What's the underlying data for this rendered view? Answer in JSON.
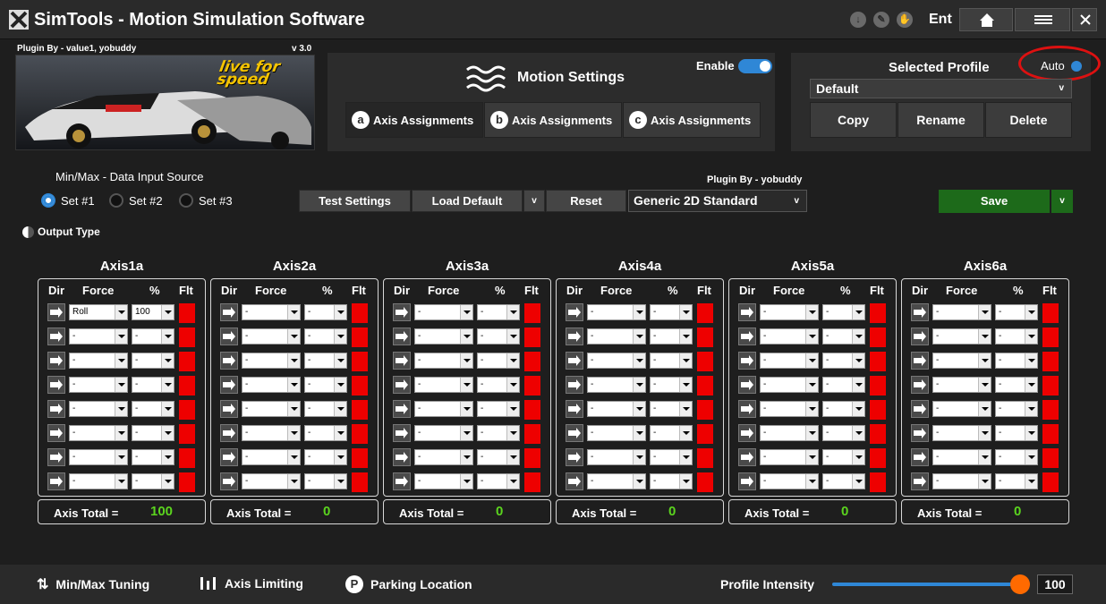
{
  "window": {
    "title": "SimTools - Motion Simulation Software",
    "user_label": "Ent"
  },
  "plugin": {
    "by": "Plugin By - value1, yobuddy",
    "version": "v 3.0",
    "banner_logo_text": "live for speed"
  },
  "motion_settings": {
    "title": "Motion Settings",
    "enable_label": "Enable",
    "enabled": true,
    "tabs": [
      {
        "letter": "a",
        "label": "Axis Assignments"
      },
      {
        "letter": "b",
        "label": "Axis Assignments"
      },
      {
        "letter": "c",
        "label": "Axis Assignments"
      }
    ]
  },
  "profile": {
    "title": "Selected Profile",
    "auto_label": "Auto",
    "auto_on": true,
    "selected": "Default",
    "buttons": {
      "copy": "Copy",
      "rename": "Rename",
      "delete": "Delete"
    }
  },
  "data_input": {
    "label": "Min/Max - Data Input Source",
    "sets": [
      "Set #1",
      "Set #2",
      "Set #3"
    ],
    "selected_set": "Set #1"
  },
  "output_type": {
    "label": "Output Type"
  },
  "toolbar": {
    "test_settings": "Test Settings",
    "load_default": "Load Default",
    "dropdown_glyph": "v",
    "reset": "Reset",
    "plugin_by": "Plugin By - yobuddy",
    "source_select": "Generic 2D Standard",
    "save": "Save"
  },
  "axis_table": {
    "headers": {
      "dir": "Dir",
      "force": "Force",
      "pct": "%",
      "flt": "Flt"
    },
    "total_label": "Axis Total =",
    "axes": [
      {
        "name": "Axis1a",
        "total": "100",
        "rows": [
          {
            "force": "Roll",
            "pct": "100"
          },
          {
            "force": "-",
            "pct": "-"
          },
          {
            "force": "-",
            "pct": "-"
          },
          {
            "force": "-",
            "pct": "-"
          },
          {
            "force": "-",
            "pct": "-"
          },
          {
            "force": "-",
            "pct": "-"
          },
          {
            "force": "-",
            "pct": "-"
          },
          {
            "force": "-",
            "pct": "-"
          }
        ]
      },
      {
        "name": "Axis2a",
        "total": "0",
        "rows": [
          {
            "force": "-",
            "pct": "-"
          },
          {
            "force": "-",
            "pct": "-"
          },
          {
            "force": "-",
            "pct": "-"
          },
          {
            "force": "-",
            "pct": "-"
          },
          {
            "force": "-",
            "pct": "-"
          },
          {
            "force": "-",
            "pct": "-"
          },
          {
            "force": "-",
            "pct": "-"
          },
          {
            "force": "-",
            "pct": "-"
          }
        ]
      },
      {
        "name": "Axis3a",
        "total": "0",
        "rows": [
          {
            "force": "-",
            "pct": "-"
          },
          {
            "force": "-",
            "pct": "-"
          },
          {
            "force": "-",
            "pct": "-"
          },
          {
            "force": "-",
            "pct": "-"
          },
          {
            "force": "-",
            "pct": "-"
          },
          {
            "force": "-",
            "pct": "-"
          },
          {
            "force": "-",
            "pct": "-"
          },
          {
            "force": "-",
            "pct": "-"
          }
        ]
      },
      {
        "name": "Axis4a",
        "total": "0",
        "rows": [
          {
            "force": "-",
            "pct": "-"
          },
          {
            "force": "-",
            "pct": "-"
          },
          {
            "force": "-",
            "pct": "-"
          },
          {
            "force": "-",
            "pct": "-"
          },
          {
            "force": "-",
            "pct": "-"
          },
          {
            "force": "-",
            "pct": "-"
          },
          {
            "force": "-",
            "pct": "-"
          },
          {
            "force": "-",
            "pct": "-"
          }
        ]
      },
      {
        "name": "Axis5a",
        "total": "0",
        "rows": [
          {
            "force": "-",
            "pct": "-"
          },
          {
            "force": "-",
            "pct": "-"
          },
          {
            "force": "-",
            "pct": "-"
          },
          {
            "force": "-",
            "pct": "-"
          },
          {
            "force": "-",
            "pct": "-"
          },
          {
            "force": "-",
            "pct": "-"
          },
          {
            "force": "-",
            "pct": "-"
          },
          {
            "force": "-",
            "pct": "-"
          }
        ]
      },
      {
        "name": "Axis6a",
        "total": "0",
        "rows": [
          {
            "force": "-",
            "pct": "-"
          },
          {
            "force": "-",
            "pct": "-"
          },
          {
            "force": "-",
            "pct": "-"
          },
          {
            "force": "-",
            "pct": "-"
          },
          {
            "force": "-",
            "pct": "-"
          },
          {
            "force": "-",
            "pct": "-"
          },
          {
            "force": "-",
            "pct": "-"
          },
          {
            "force": "-",
            "pct": "-"
          }
        ]
      }
    ]
  },
  "bottom_bar": {
    "minmax_tuning": "Min/Max Tuning",
    "axis_limiting": "Axis Limiting",
    "parking_location": "Parking Location",
    "parking_icon_letter": "P",
    "profile_intensity_label": "Profile Intensity",
    "profile_intensity_value": "100"
  },
  "colors": {
    "accent_blue": "#2f87d6",
    "save_green": "#1d6a1a",
    "total_green": "#5bd41e",
    "flt_red": "#ee0000",
    "slider_orange": "#ff6a00",
    "highlight_circle": "#d11111"
  },
  "icons": {
    "app": "simtools-logo-icon",
    "title_bar": [
      "download-icon",
      "edit-icon",
      "hand-icon",
      "home-icon",
      "hamburger-menu-icon",
      "close-icon"
    ],
    "motion": "waves-icon",
    "dir": "arrow-right-icon",
    "output_type": "half-circle-icon",
    "minmax": "updown-arrows-icon",
    "axis_limiting": "bars-icon",
    "parking": "parking-icon"
  }
}
